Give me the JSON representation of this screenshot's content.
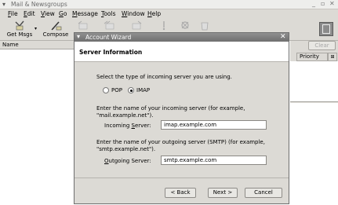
{
  "window": {
    "title": "Mail & Newsgroups",
    "controls": [
      "_",
      "▫",
      "✕"
    ]
  },
  "menu": {
    "items": [
      {
        "first": "F",
        "rest": "ile"
      },
      {
        "first": "E",
        "rest": "dit"
      },
      {
        "first": "V",
        "rest": "iew"
      },
      {
        "first": "G",
        "rest": "o"
      },
      {
        "first": "M",
        "rest": "essage"
      },
      {
        "first": "T",
        "rest": "ools"
      },
      {
        "first": "W",
        "rest": "indow"
      },
      {
        "first": "H",
        "rest": "elp"
      }
    ]
  },
  "toolbar": {
    "get_msgs_label": "Get Msgs",
    "compose_label": "Compose"
  },
  "list": {
    "name_header": "Name",
    "clear_label": "Clear",
    "priority_header": "Priority"
  },
  "dialog": {
    "title": "Account Wizard",
    "close_glyph": "✕",
    "section_title": "Server Information",
    "select_type_text": "Select the type of incoming server you are using.",
    "pop_label": "POP",
    "imap_label": "IMAP",
    "selected_type": "IMAP",
    "incoming_instructions_line1": "Enter the name of your incoming server (for example,",
    "incoming_instructions_line2": "\"mail.example.net\").",
    "incoming_label_first": "Incoming ",
    "incoming_label_ul": "S",
    "incoming_label_rest": "erver:",
    "incoming_value": "imap.example.com",
    "outgoing_instructions_line1": "Enter the name of your outgoing server (SMTP) (for example,",
    "outgoing_instructions_line2": "\"smtp.example.net\").",
    "outgoing_label_first": "",
    "outgoing_label_ul": "O",
    "outgoing_label_rest": "utgoing Server:",
    "outgoing_value": "smtp.example.com",
    "back_label": "< Back",
    "next_label": "Next >",
    "cancel_label": "Cancel"
  }
}
